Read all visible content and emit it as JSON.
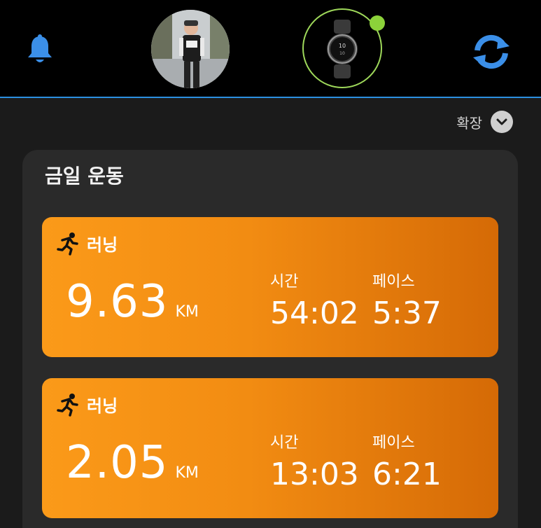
{
  "header": {
    "icons": {
      "left": "bell-icon",
      "right": "sync-icon"
    },
    "device_status_color": "#8cd23a",
    "accent_color": "#2b8fe0"
  },
  "expand": {
    "label": "확장",
    "icon": "chevron-down-icon"
  },
  "today": {
    "title": "금일 운동",
    "activities": [
      {
        "type": "러닝",
        "icon": "running-icon",
        "distance": "9.63",
        "unit": "KM",
        "time_label": "시간",
        "time": "54:02",
        "pace_label": "페이스",
        "pace": "5:37"
      },
      {
        "type": "러닝",
        "icon": "running-icon",
        "distance": "2.05",
        "unit": "KM",
        "time_label": "시간",
        "time": "13:03",
        "pace_label": "페이스",
        "pace": "6:21"
      }
    ]
  }
}
